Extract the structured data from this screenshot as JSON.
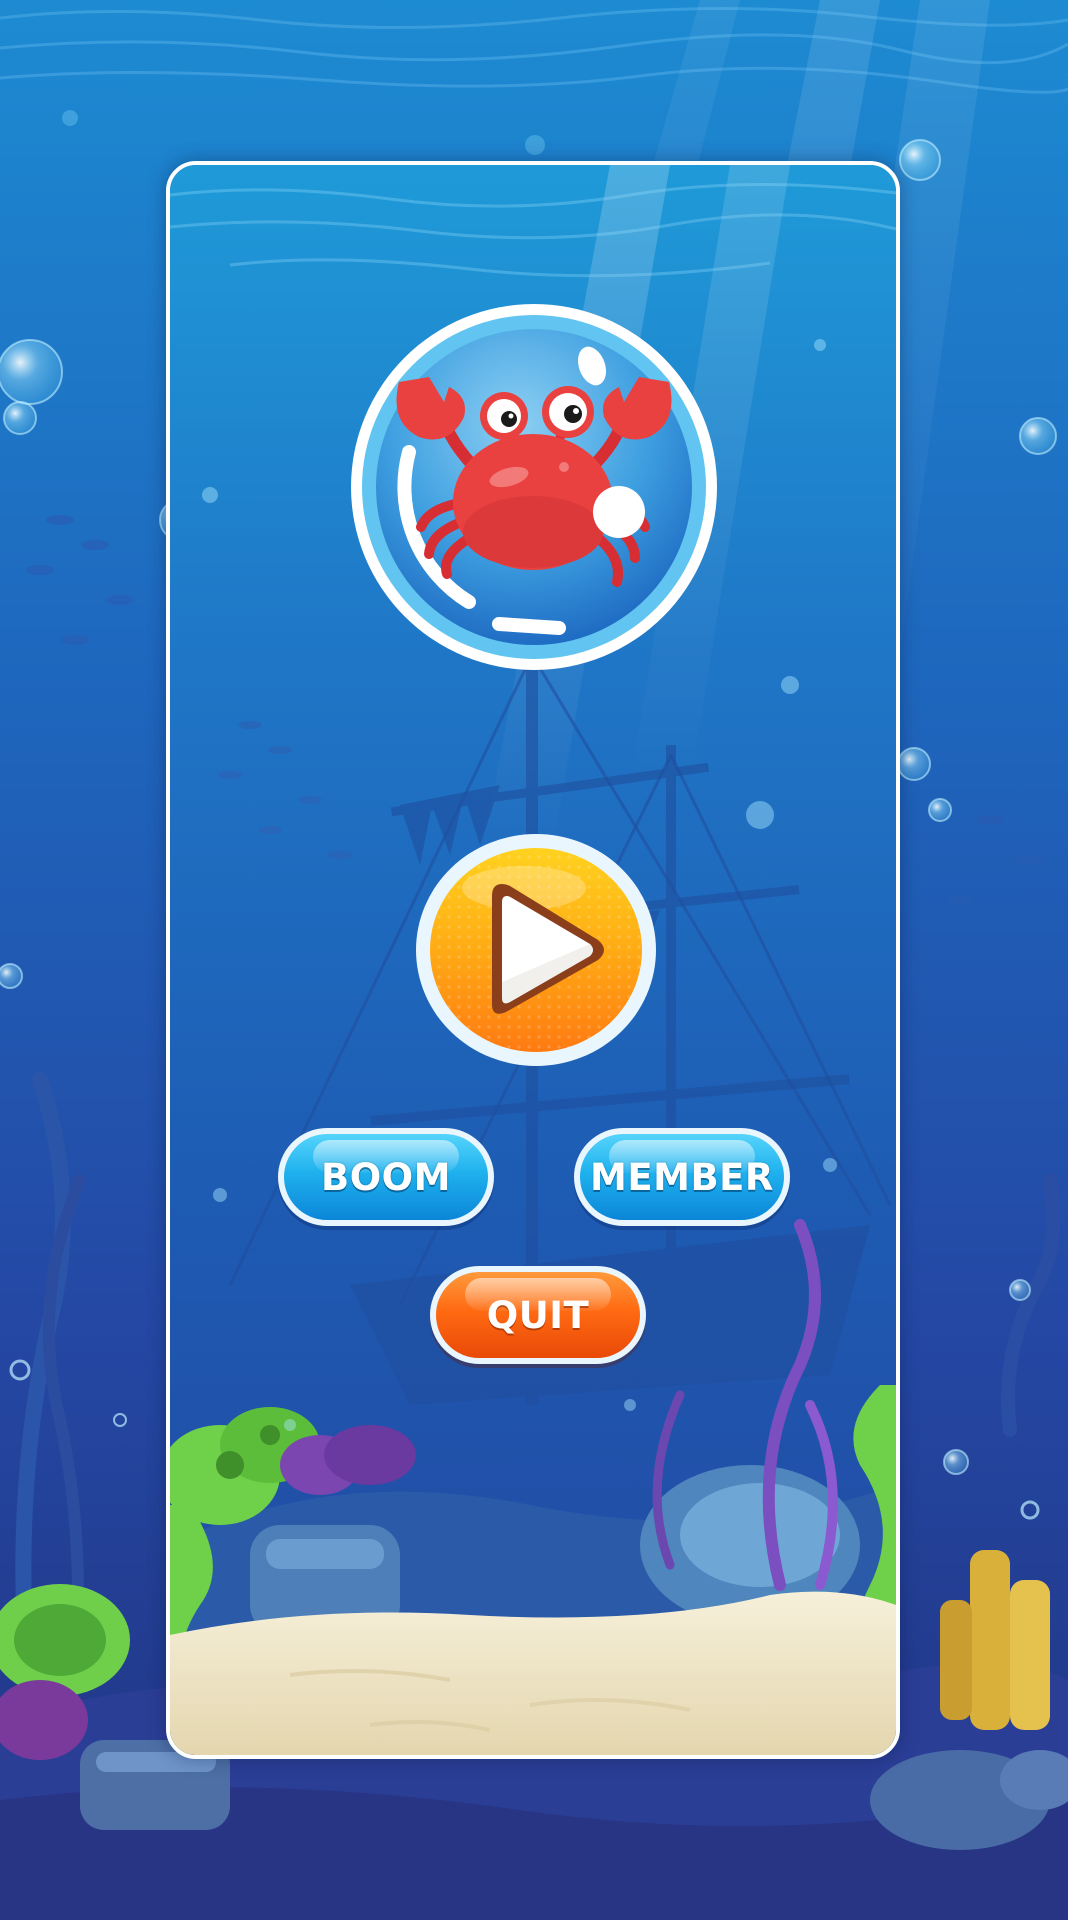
{
  "screen": {
    "name": "main-menu"
  },
  "buttons": {
    "play_icon": "play-icon",
    "boom_label": "BOOM",
    "member_label": "MEMBER",
    "quit_label": "QUIT"
  },
  "avatar": {
    "icon": "crab-icon"
  },
  "colors": {
    "ocean_top": "#1e86cf",
    "ocean_bottom": "#233d9a",
    "play_orange": "#ff8a10",
    "play_yellow": "#ffc21a",
    "pill_blue": "#1fb1ee",
    "pill_orange": "#ff6a12",
    "crab_red": "#e8413f",
    "sand": "#f1e8cf"
  }
}
